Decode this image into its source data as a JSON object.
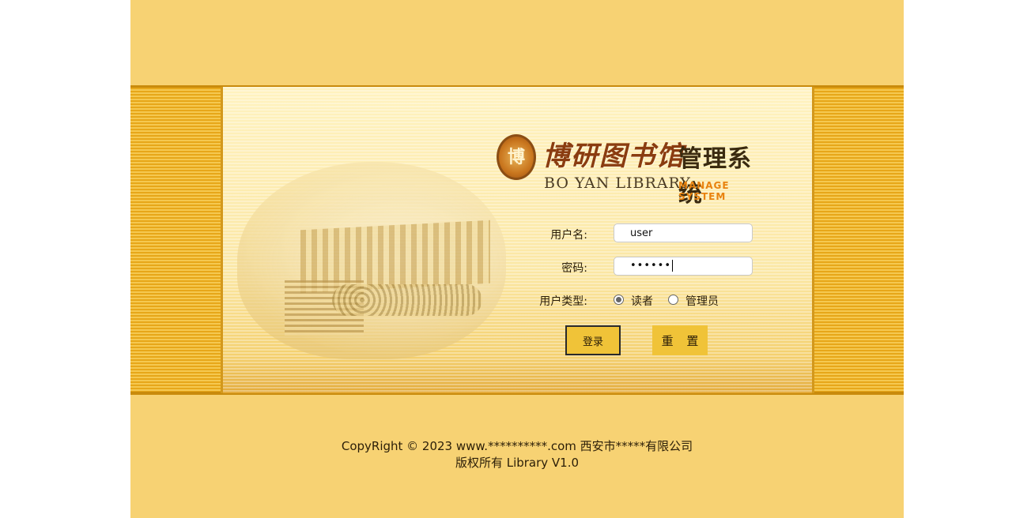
{
  "logo": {
    "seal_glyph": "博",
    "calligraphy": "博研图书馆",
    "system": "管理系统",
    "english_name": "BO YAN LIBRARY",
    "english_system": "MANAGE SYSTEM"
  },
  "form": {
    "username_label": "用户名:",
    "username_value": "user",
    "password_label": "密码:",
    "password_value": "••••••",
    "usertype_label": "用户类型:",
    "usertype_options": [
      {
        "label": "读者",
        "checked": true
      },
      {
        "label": "管理员",
        "checked": false
      }
    ],
    "login_label": "登录",
    "reset_label": "重 置"
  },
  "footer": {
    "line1": "CopyRight © 2023 www.**********.com 西安市*****有限公司",
    "line2": "版权所有 Library V1.0"
  },
  "colors": {
    "page_bg": "#f7d273",
    "band": "#e7a719",
    "button": "#f0c338",
    "accent_orange": "#e8820e"
  }
}
